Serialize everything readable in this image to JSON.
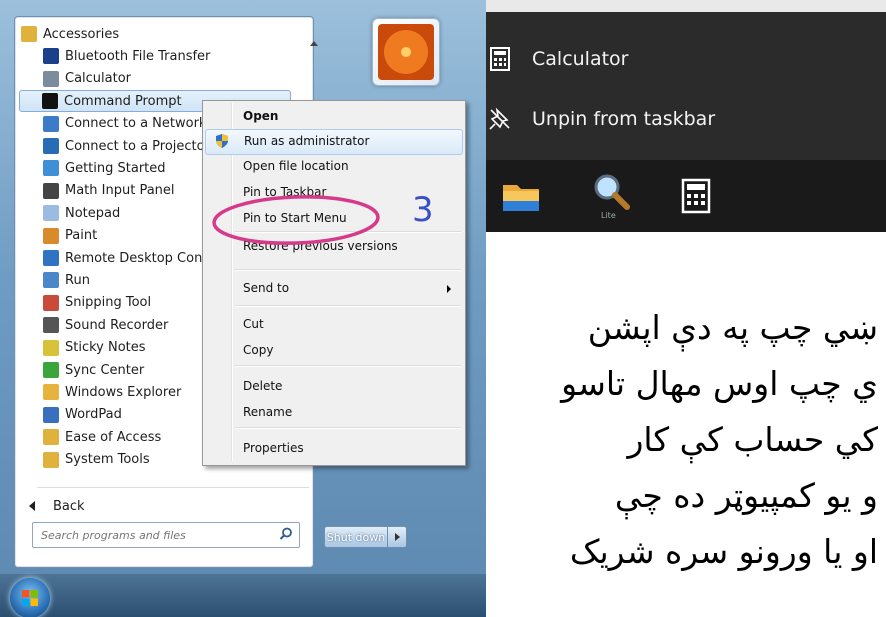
{
  "start_menu": {
    "programs": [
      {
        "label": "Accessories",
        "icon": "folder-icon"
      },
      {
        "label": "Bluetooth File Transfer",
        "icon": "bluetooth-icon"
      },
      {
        "label": "Calculator",
        "icon": "calculator-icon"
      },
      {
        "label": "Command Prompt",
        "icon": "command-prompt-icon"
      },
      {
        "label": "Connect to a Network",
        "icon": "network-projector-icon"
      },
      {
        "label": "Connect to a Projector",
        "icon": "projector-icon"
      },
      {
        "label": "Getting Started",
        "icon": "getting-started-icon"
      },
      {
        "label": "Math Input Panel",
        "icon": "math-input-icon"
      },
      {
        "label": "Notepad",
        "icon": "notepad-icon"
      },
      {
        "label": "Paint",
        "icon": "paint-icon"
      },
      {
        "label": "Remote Desktop Connection",
        "icon": "remote-desktop-icon"
      },
      {
        "label": "Run",
        "icon": "run-icon"
      },
      {
        "label": "Snipping Tool",
        "icon": "scissors-icon"
      },
      {
        "label": "Sound Recorder",
        "icon": "microphone-icon"
      },
      {
        "label": "Sticky Notes",
        "icon": "sticky-notes-icon"
      },
      {
        "label": "Sync Center",
        "icon": "sync-icon"
      },
      {
        "label": "Windows Explorer",
        "icon": "explorer-icon"
      },
      {
        "label": "WordPad",
        "icon": "wordpad-icon"
      },
      {
        "label": "Ease of Access",
        "icon": "folder-icon"
      },
      {
        "label": "System Tools",
        "icon": "folder-icon"
      }
    ],
    "back_label": "Back",
    "search_placeholder": "Search programs and files",
    "shutdown_label": "Shut down"
  },
  "context_menu": {
    "items": [
      {
        "label": "Open",
        "bold": true
      },
      {
        "label": "Run as administrator"
      },
      {
        "label": "Open file location"
      },
      {
        "label": "Pin to Taskbar"
      },
      {
        "label": "Pin to Start Menu"
      },
      {
        "label": "Restore previous versions"
      },
      {
        "label": "Send to"
      },
      {
        "label": "Cut"
      },
      {
        "label": "Copy"
      },
      {
        "label": "Delete"
      },
      {
        "label": "Rename"
      },
      {
        "label": "Properties"
      }
    ]
  },
  "annotation": {
    "step_number": "3",
    "circle_color": "#d63a8a",
    "number_color": "#3a4fc3"
  },
  "taskbar_jumplist": {
    "items": [
      {
        "label": "Calculator",
        "icon": "calculator-icon"
      },
      {
        "label": "Unpin from taskbar",
        "icon": "unpin-icon"
      }
    ],
    "tiles": [
      {
        "icon": "file-explorer-icon"
      },
      {
        "icon": "magnifier-icon",
        "caption": "Lite"
      },
      {
        "icon": "calculator-icon"
      }
    ]
  },
  "pashto_text": [
    "ښي چپ په دې اپشن",
    "ي چپ اوس مهال تاسو",
    "کي حساب کې کار",
    "و يو کمپيوټر ده چې",
    "او يا ورونو سره شريک"
  ]
}
